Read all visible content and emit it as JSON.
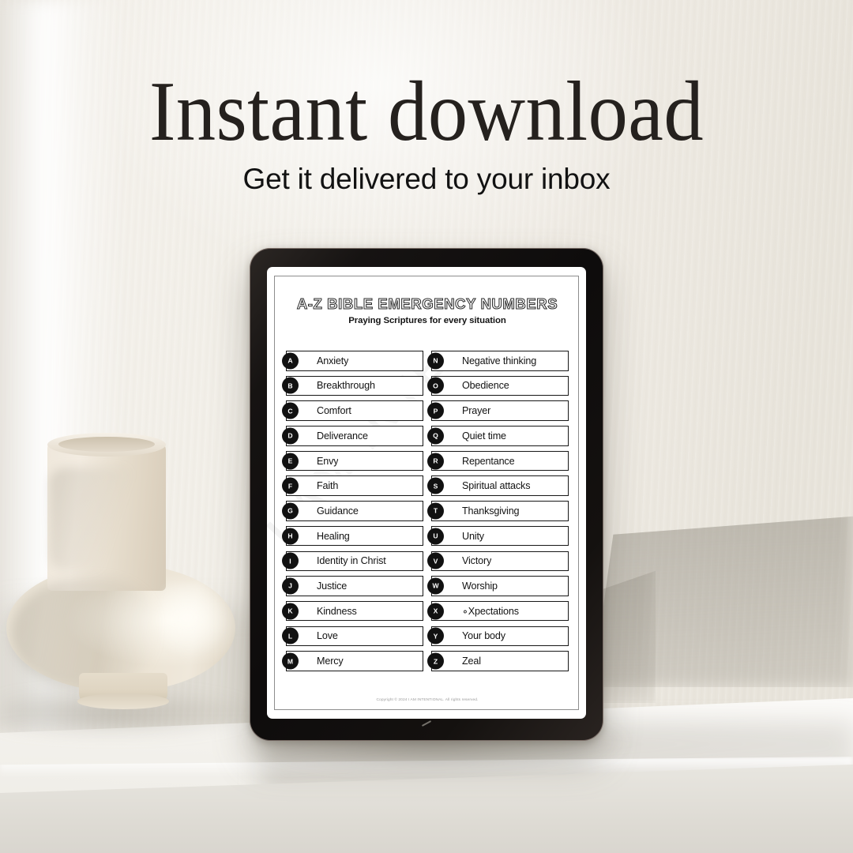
{
  "promo": {
    "headline": "Instant download",
    "subheadline": "Get it delivered to your inbox"
  },
  "scene": {
    "background_color": "#efece5",
    "table_color": "#f3f1ec",
    "vase_color": "#e9e2d4",
    "tablet_bezel_color": "#0e0c0c"
  },
  "document": {
    "title": "A-Z BIBLE EMERGENCY NUMBERS",
    "subtitle": "Praying Scriptures for every situation",
    "watermark": "I AM INTENTIONAL",
    "footer": "Copyright © 2024 I AM INTENTIONAL. All rights reserved.",
    "accent_color": "#111111",
    "left_column": [
      {
        "letter": "A",
        "label": "Anxiety"
      },
      {
        "letter": "B",
        "label": "Breakthrough"
      },
      {
        "letter": "C",
        "label": "Comfort"
      },
      {
        "letter": "D",
        "label": "Deliverance"
      },
      {
        "letter": "E",
        "label": "Envy"
      },
      {
        "letter": "F",
        "label": "Faith"
      },
      {
        "letter": "G",
        "label": "Guidance"
      },
      {
        "letter": "H",
        "label": "Healing"
      },
      {
        "letter": "I",
        "label": "Identity in Christ"
      },
      {
        "letter": "J",
        "label": "Justice"
      },
      {
        "letter": "K",
        "label": "Kindness"
      },
      {
        "letter": "L",
        "label": "Love"
      },
      {
        "letter": "M",
        "label": "Mercy"
      }
    ],
    "right_column": [
      {
        "letter": "N",
        "label": "Negative thinking"
      },
      {
        "letter": "O",
        "label": "Obedience"
      },
      {
        "letter": "P",
        "label": "Prayer"
      },
      {
        "letter": "Q",
        "label": "Quiet time"
      },
      {
        "letter": "R",
        "label": "Repentance"
      },
      {
        "letter": "S",
        "label": "Spiritual attacks"
      },
      {
        "letter": "T",
        "label": "Thanksgiving"
      },
      {
        "letter": "U",
        "label": "Unity"
      },
      {
        "letter": "V",
        "label": "Victory"
      },
      {
        "letter": "W",
        "label": "Worship"
      },
      {
        "letter": "X",
        "label": "∘Xpectations"
      },
      {
        "letter": "Y",
        "label": "Your body"
      },
      {
        "letter": "Z",
        "label": "Zeal"
      }
    ]
  }
}
